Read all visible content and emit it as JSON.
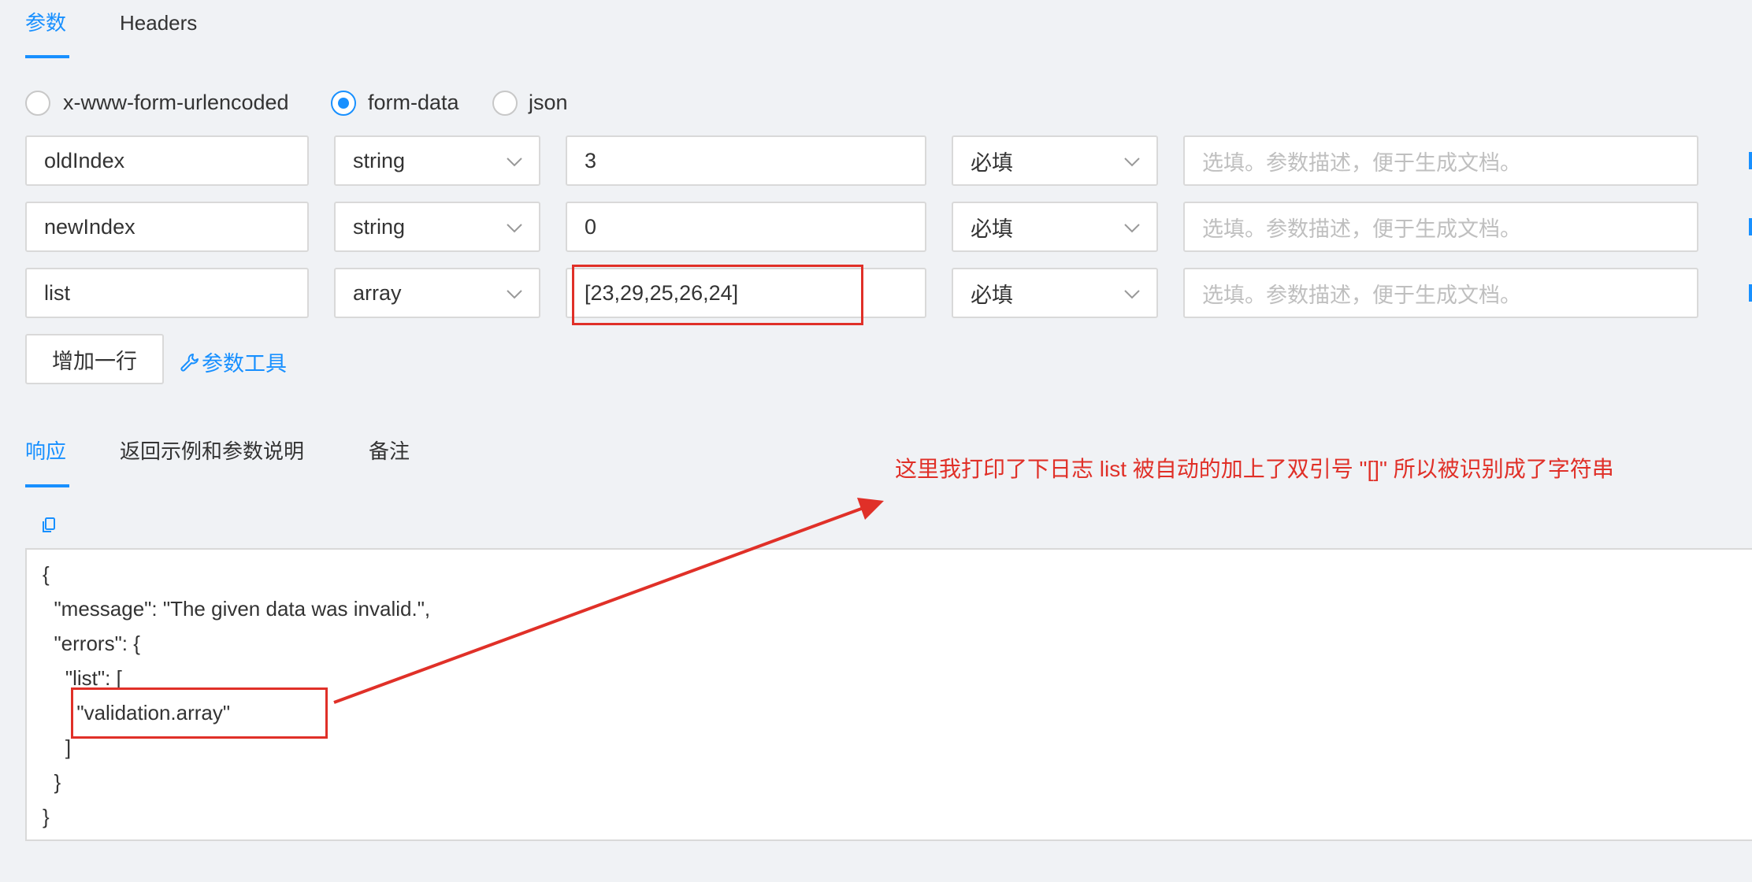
{
  "top_tabs": [
    {
      "label": "参数",
      "active": true
    },
    {
      "label": "Headers",
      "active": false
    }
  ],
  "body_types": [
    {
      "label": "x-www-form-urlencoded",
      "checked": false
    },
    {
      "label": "form-data",
      "checked": true
    },
    {
      "label": "json",
      "checked": false
    }
  ],
  "params": [
    {
      "name": "oldIndex",
      "type": "string",
      "value": "3",
      "required": "必填",
      "desc_placeholder": "选填。参数描述，便于生成文档。"
    },
    {
      "name": "newIndex",
      "type": "string",
      "value": "0",
      "required": "必填",
      "desc_placeholder": "选填。参数描述，便于生成文档。"
    },
    {
      "name": "list",
      "type": "array",
      "value": "[23,29,25,26,24]",
      "required": "必填",
      "desc_placeholder": "选填。参数描述，便于生成文档。"
    }
  ],
  "actions": {
    "add_row": "增加一行",
    "param_tool": "参数工具"
  },
  "response_tabs": [
    {
      "label": "响应",
      "active": true
    },
    {
      "label": "返回示例和参数说明",
      "active": false
    },
    {
      "label": "备注",
      "active": false
    }
  ],
  "response_lines": [
    "{",
    "  \"message\": \"The given data was invalid.\",",
    "  \"errors\": {",
    "    \"list\": [",
    "      \"validation.array\"",
    "    ]",
    "  }",
    "}"
  ],
  "annotation": "这里我打印了下日志  list 被自动的加上了双引号 \"[]\" 所以被识别成了字符串",
  "colors": {
    "accent": "#1890ff",
    "annotation_red": "#e03028",
    "background": "#f0f2f5"
  },
  "icons": {
    "copy": "copy-icon",
    "wrench": "wrench-icon",
    "chevron": "chevron-down-icon"
  }
}
